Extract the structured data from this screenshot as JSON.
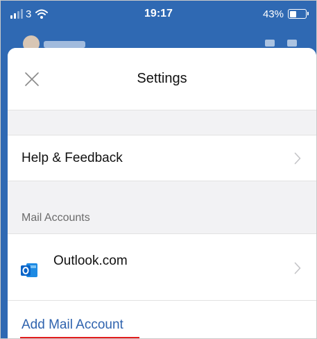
{
  "status_bar": {
    "carrier": "3",
    "time": "19:17",
    "battery_percent_label": "43%",
    "battery_level": 0.43
  },
  "settings": {
    "title": "Settings",
    "help_feedback_label": "Help & Feedback",
    "mail_accounts_section_label": "Mail Accounts",
    "account_label": "Outlook.com",
    "add_account_label": "Add Mail Account"
  },
  "colors": {
    "brand_blue": "#2f69b3",
    "link_blue": "#2f63ae",
    "underline_red": "#e21c1c",
    "outlook_blue": "#0a64c8"
  },
  "icons": {
    "close": "close-icon",
    "chevron": "chevron-right-icon",
    "outlook": "outlook-icon",
    "wifi": "wifi-icon",
    "signal": "signal-icon",
    "battery": "battery-icon"
  }
}
